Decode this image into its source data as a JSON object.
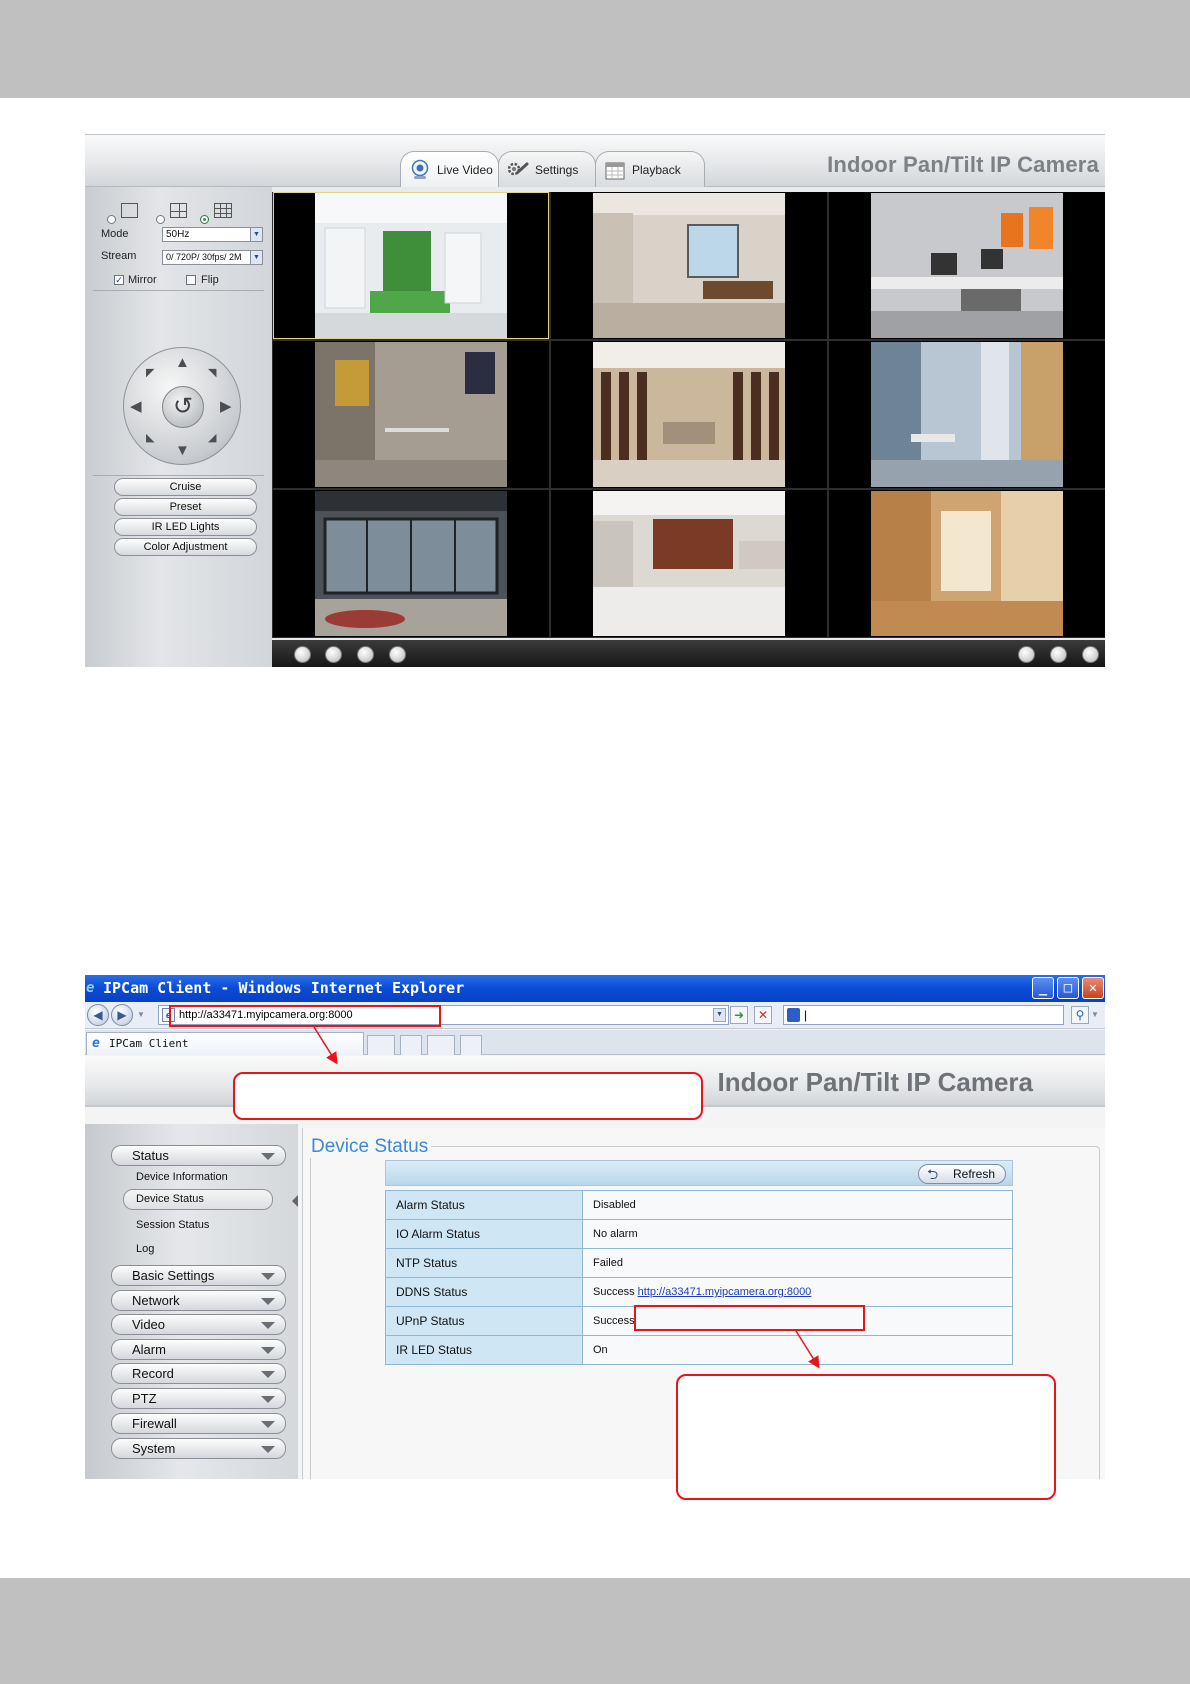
{
  "live_video": {
    "tabs": [
      {
        "label": "Live Video",
        "icon": "webcam-icon",
        "active": true
      },
      {
        "label": "Settings",
        "icon": "wrench-gear-icon",
        "active": false
      },
      {
        "label": "Playback",
        "icon": "calendar-icon",
        "active": false
      }
    ],
    "title": "Indoor Pan/Tilt IP Camera",
    "mode_label": "Mode",
    "mode_value": "50Hz",
    "stream_label": "Stream",
    "stream_value": "0/ 720P/ 30fps/ 2M",
    "mirror_label": "Mirror",
    "mirror_checked": true,
    "flip_label": "Flip",
    "flip_checked": false,
    "buttons": [
      "Cruise",
      "Preset",
      "IR LED Lights",
      "Color Adjustment"
    ],
    "channels": 9
  },
  "ie_window": {
    "window_title": "IPCam Client - Windows Internet Explorer",
    "url": "http://a33471.myipcamera.org:8000",
    "search_value": "|",
    "tab_title": "IPCam Client",
    "app_title": "Indoor Pan/Tilt IP Camera",
    "sidebar": {
      "menus": [
        "Status",
        "Basic Settings",
        "Network",
        "Video",
        "Alarm",
        "Record",
        "PTZ",
        "Firewall",
        "System"
      ],
      "status_items": [
        "Device Information",
        "Device Status",
        "Session Status",
        "Log"
      ],
      "active_item": "Device Status"
    },
    "section_title": "Device Status",
    "refresh_label": "Refresh",
    "rows": [
      {
        "key": "Alarm Status",
        "value": "Disabled"
      },
      {
        "key": "IO Alarm Status",
        "value": "No alarm"
      },
      {
        "key": "NTP Status",
        "value": "Failed"
      },
      {
        "key": "DDNS Status",
        "value": "Success",
        "link": "http://a33471.myipcamera.org:8000"
      },
      {
        "key": "UPnP Status",
        "value": "Success"
      },
      {
        "key": "IR LED Status",
        "value": "On"
      }
    ]
  },
  "colors": {
    "annotation": "#e8141b",
    "ie_titlebar": "#0a4bd6",
    "legend_blue": "#3c88d6"
  }
}
